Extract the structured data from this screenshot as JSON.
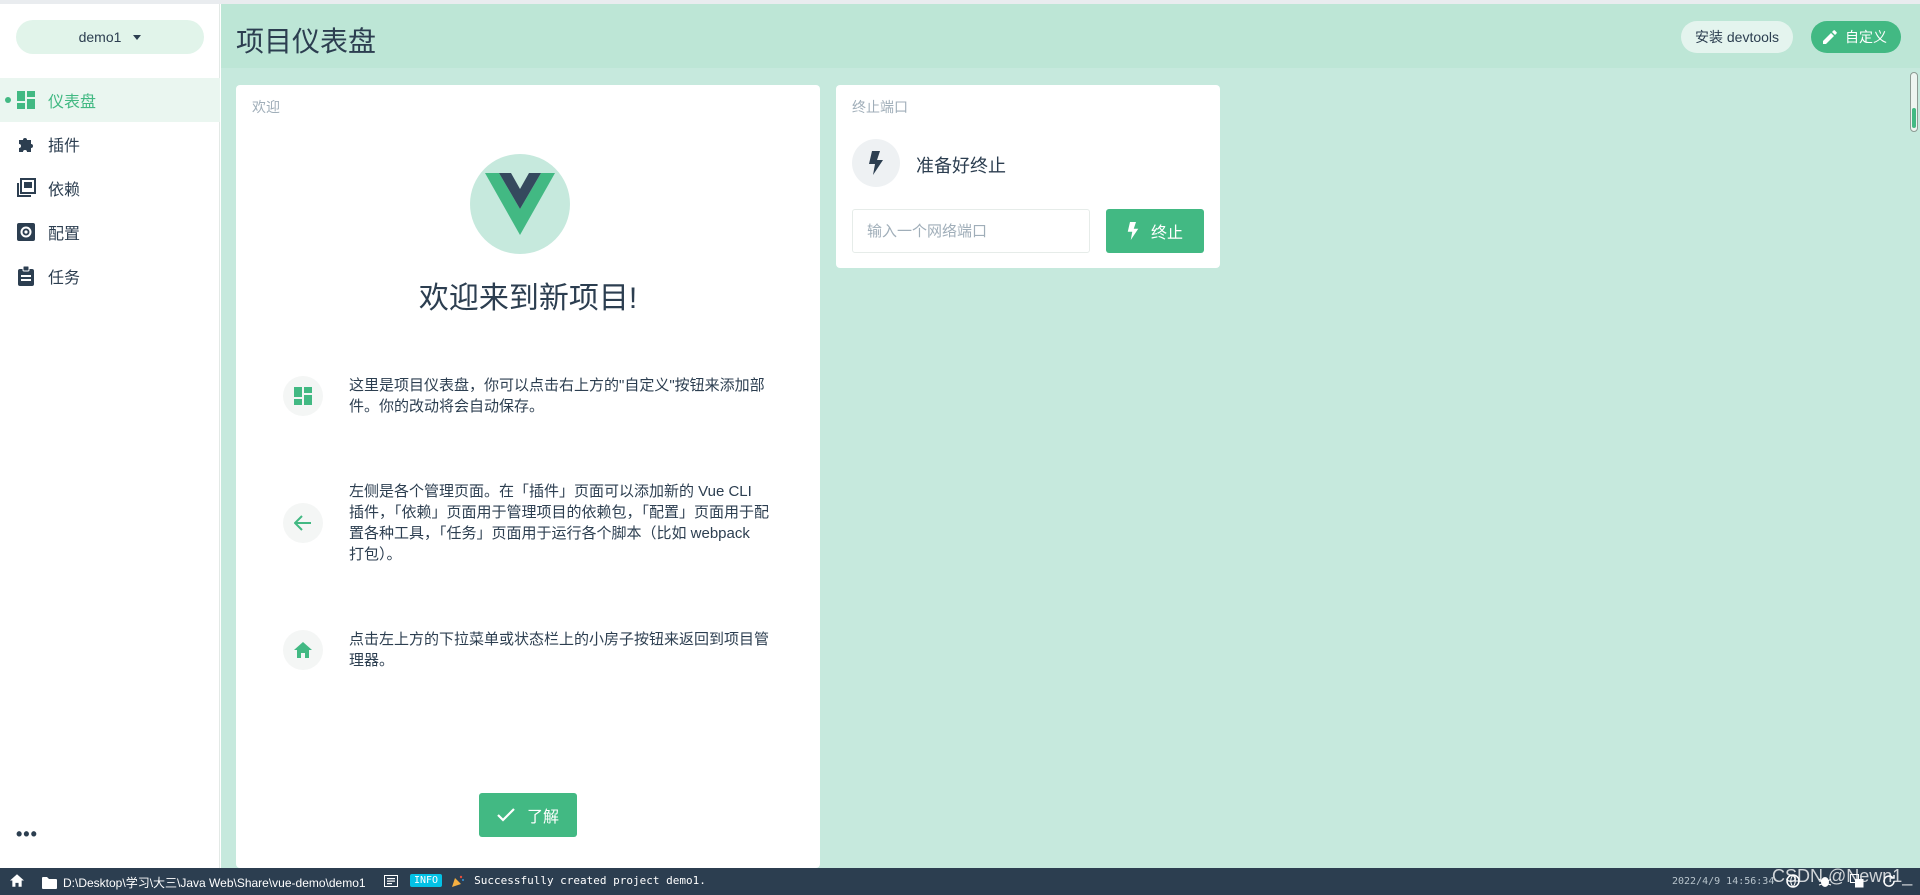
{
  "sidebar": {
    "project_name": "demo1",
    "items": [
      {
        "label": "仪表盘",
        "icon": "dashboard-icon",
        "active": true
      },
      {
        "label": "插件",
        "icon": "puzzle-icon",
        "active": false
      },
      {
        "label": "依赖",
        "icon": "library-icon",
        "active": false
      },
      {
        "label": "配置",
        "icon": "gear-icon",
        "active": false
      },
      {
        "label": "任务",
        "icon": "clipboard-icon",
        "active": false
      }
    ],
    "more_label": "•••"
  },
  "header": {
    "title": "项目仪表盘",
    "devtools_label": "安装 devtools",
    "customize_label": "自定义"
  },
  "welcome": {
    "card_title": "欢迎",
    "heading": "欢迎来到新项目!",
    "tips": [
      {
        "icon": "dashboard-icon",
        "text": "这里是项目仪表盘，你可以点击右上方的\"自定义\"按钮来添加部件。你的改动将会自动保存。"
      },
      {
        "icon": "arrow-left-icon",
        "text": "左侧是各个管理页面。在「插件」页面可以添加新的 Vue CLI 插件，「依赖」页面用于管理项目的依赖包，「配置」页面用于配置各种工具，「任务」页面用于运行各个脚本（比如 webpack 打包）。"
      },
      {
        "icon": "home-icon",
        "text": "点击左上方的下拉菜单或状态栏上的小房子按钮来返回到项目管理器。"
      }
    ],
    "ok_label": "了解"
  },
  "kill_port": {
    "card_title": "终止端口",
    "status": "准备好终止",
    "input_placeholder": "输入一个网络端口",
    "input_value": "",
    "button_label": "终止"
  },
  "statusbar": {
    "path": "D:\\Desktop\\学习\\大三\\Java Web\\Share\\vue-demo\\demo1",
    "log_level": "INFO",
    "log_message": "Successfully created project demo1.",
    "timestamp": "2022/4/9 14:56:34"
  },
  "watermark": "CSDN @Newn1_",
  "colors": {
    "accent": "#42b983",
    "dark": "#2c3e50",
    "main_bg": "#c6e9dd",
    "info_badge": "#03c2e6"
  }
}
